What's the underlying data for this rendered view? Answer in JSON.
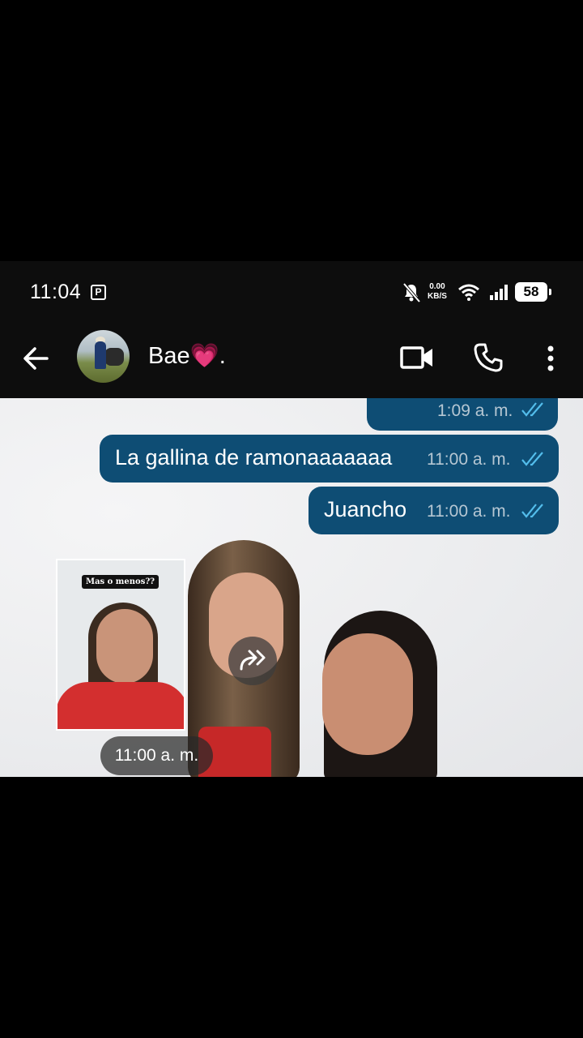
{
  "status_bar": {
    "time": "11:04",
    "notification_icon": "P",
    "net_speed_value": "0.00",
    "net_speed_unit": "KB/S",
    "battery": "58"
  },
  "header": {
    "contact_name": "Bae💗."
  },
  "messages": [
    {
      "text": "",
      "time": "1:09 a. m.",
      "status": "read"
    },
    {
      "text": "La gallina de ramonaaaaaaa",
      "time": "11:00 a. m.",
      "status": "read"
    },
    {
      "text": "Juancho",
      "time": "11:00 a. m.",
      "status": "read"
    }
  ],
  "image_message": {
    "inset_caption": "Mas o menos??",
    "time": "11:00 a. m."
  },
  "colors": {
    "bubble_out": "#0e4d74",
    "read_ticks": "#53bdeb",
    "bar_bg": "#0d0d0d"
  }
}
